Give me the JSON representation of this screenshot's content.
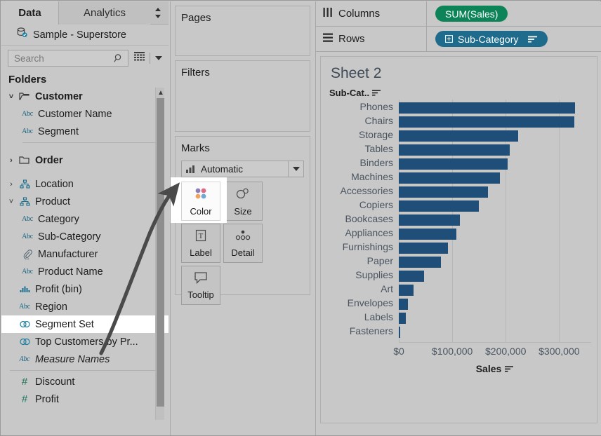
{
  "window": {
    "background": "#c8c8c8"
  },
  "colors": {
    "measure_green": "#0d8457",
    "dimension_blue": "#1f6b8c",
    "bar_blue": "#1f4e79",
    "text_dark": "#1c1c1c",
    "axis_text": "#4a5560",
    "highlight_white": "#ffffff"
  },
  "left_pane": {
    "tabs": [
      {
        "label": "Data",
        "active": true,
        "name": "tab-data"
      },
      {
        "label": "Analytics",
        "active": false,
        "name": "tab-analytics"
      }
    ],
    "spinner_icon": "up-down-spinner-icon",
    "datasource": {
      "icon": "database-icon",
      "label": "Sample - Superstore"
    },
    "search": {
      "placeholder": "Search",
      "value": "",
      "search_icon": "search-icon",
      "grid_icon": "grid-view-icon",
      "caret_icon": "chevron-down-icon"
    },
    "section_title": "Folders",
    "fields": [
      {
        "label": "Customer",
        "icon": "folder-open-icon",
        "twisty": "expanded",
        "bold": true,
        "indent": 0
      },
      {
        "label": "Customer Name",
        "icon": "abc-icon",
        "twisty": "none",
        "bold": false,
        "indent": 1
      },
      {
        "label": "Segment",
        "icon": "abc-icon",
        "twisty": "none",
        "bold": false,
        "indent": 1
      },
      {
        "label": "Order",
        "icon": "folder-closed-icon",
        "twisty": "collapsed",
        "bold": true,
        "indent": 0
      },
      {
        "label": "Location",
        "icon": "hierarchy-icon",
        "twisty": "collapsed",
        "bold": false,
        "indent": 0
      },
      {
        "label": "Product",
        "icon": "hierarchy-icon",
        "twisty": "expanded",
        "bold": false,
        "indent": 0
      },
      {
        "label": "Category",
        "icon": "abc-icon",
        "twisty": "none",
        "bold": false,
        "indent": 1
      },
      {
        "label": "Sub-Category",
        "icon": "abc-icon",
        "twisty": "none",
        "bold": false,
        "indent": 1
      },
      {
        "label": "Manufacturer",
        "icon": "paperclip-icon",
        "twisty": "none",
        "bold": false,
        "indent": 1
      },
      {
        "label": "Product Name",
        "icon": "abc-icon",
        "twisty": "none",
        "bold": false,
        "indent": 1
      },
      {
        "label": "Profit (bin)",
        "icon": "bin-histogram-icon",
        "twisty": "none",
        "bold": false,
        "indent": 0
      },
      {
        "label": "Region",
        "icon": "abc-icon",
        "twisty": "none",
        "bold": false,
        "indent": 0
      },
      {
        "label": "Segment Set",
        "icon": "set-icon",
        "twisty": "none",
        "bold": false,
        "indent": 0,
        "highlight": true
      },
      {
        "label": "Top Customers by Pr...",
        "icon": "set-icon",
        "twisty": "none",
        "bold": false,
        "indent": 0
      },
      {
        "label": "Measure Names",
        "icon": "abc-icon",
        "twisty": "none",
        "bold": false,
        "indent": 0,
        "italic": true
      },
      {
        "label": "Discount",
        "icon": "number-icon",
        "twisty": "none",
        "bold": false,
        "indent": 0
      },
      {
        "label": "Profit",
        "icon": "number-icon",
        "twisty": "none",
        "bold": false,
        "indent": 0
      }
    ],
    "scrollbar": {
      "name": "fields-scrollbar",
      "up_arrow_icon": "chevron-up-icon"
    }
  },
  "mid_pane": {
    "pages_card": {
      "title": "Pages"
    },
    "filters_card": {
      "title": "Filters"
    },
    "marks_card": {
      "title": "Marks",
      "mark_type": {
        "value": "Automatic",
        "icon": "bar-mark-icon",
        "dropdown_icon": "chevron-down-icon"
      },
      "buttons": [
        {
          "label": "Color",
          "icon": "color-dots-icon",
          "selected": true
        },
        {
          "label": "Size",
          "icon": "size-circles-icon",
          "selected": false
        },
        {
          "label": "Label",
          "icon": "label-T-icon",
          "selected": false
        },
        {
          "label": "Detail",
          "icon": "detail-dots-icon",
          "selected": false
        },
        {
          "label": "Tooltip",
          "icon": "tooltip-icon",
          "selected": false
        }
      ]
    }
  },
  "right_pane": {
    "columns_shelf": {
      "label": "Columns",
      "icon": "columns-icon",
      "pill": {
        "text": "SUM(Sales)",
        "type": "measure",
        "color": "#0d8457"
      }
    },
    "rows_shelf": {
      "label": "Rows",
      "icon": "rows-icon",
      "pill": {
        "text": "Sub-Category",
        "type": "dimension",
        "color": "#1f6b8c",
        "prefix_icon": "expand-plus-icon",
        "suffix_icon": "sort-descending-icon"
      }
    },
    "sheet_title": "Sheet 2",
    "row_header_label": "Sub-Cat..",
    "row_header_sort_icon": "sort-descending-icon",
    "axis_title": "Sales",
    "axis_title_sort_icon": "sort-descending-icon"
  },
  "chart_data": {
    "type": "bar",
    "title": "Sheet 2",
    "orientation": "horizontal",
    "xlabel": "Sales",
    "ylabel": "Sub-Cat..",
    "xlim": [
      0,
      360000
    ],
    "xticks": [
      0,
      100000,
      200000,
      300000
    ],
    "xtick_labels": [
      "$0",
      "$100,000",
      "$200,000",
      "$300,000"
    ],
    "grid": true,
    "legend": "none",
    "bar_color": "#1f4e79",
    "categories": [
      "Phones",
      "Chairs",
      "Storage",
      "Tables",
      "Binders",
      "Machines",
      "Accessories",
      "Copiers",
      "Bookcases",
      "Appliances",
      "Furnishings",
      "Paper",
      "Supplies",
      "Art",
      "Envelopes",
      "Labels",
      "Fasteners"
    ],
    "values": [
      330007,
      328449,
      223844,
      206966,
      203413,
      189239,
      167380,
      149528,
      114880,
      107532,
      91705,
      78479,
      46674,
      27119,
      16476,
      12486,
      3024
    ]
  }
}
